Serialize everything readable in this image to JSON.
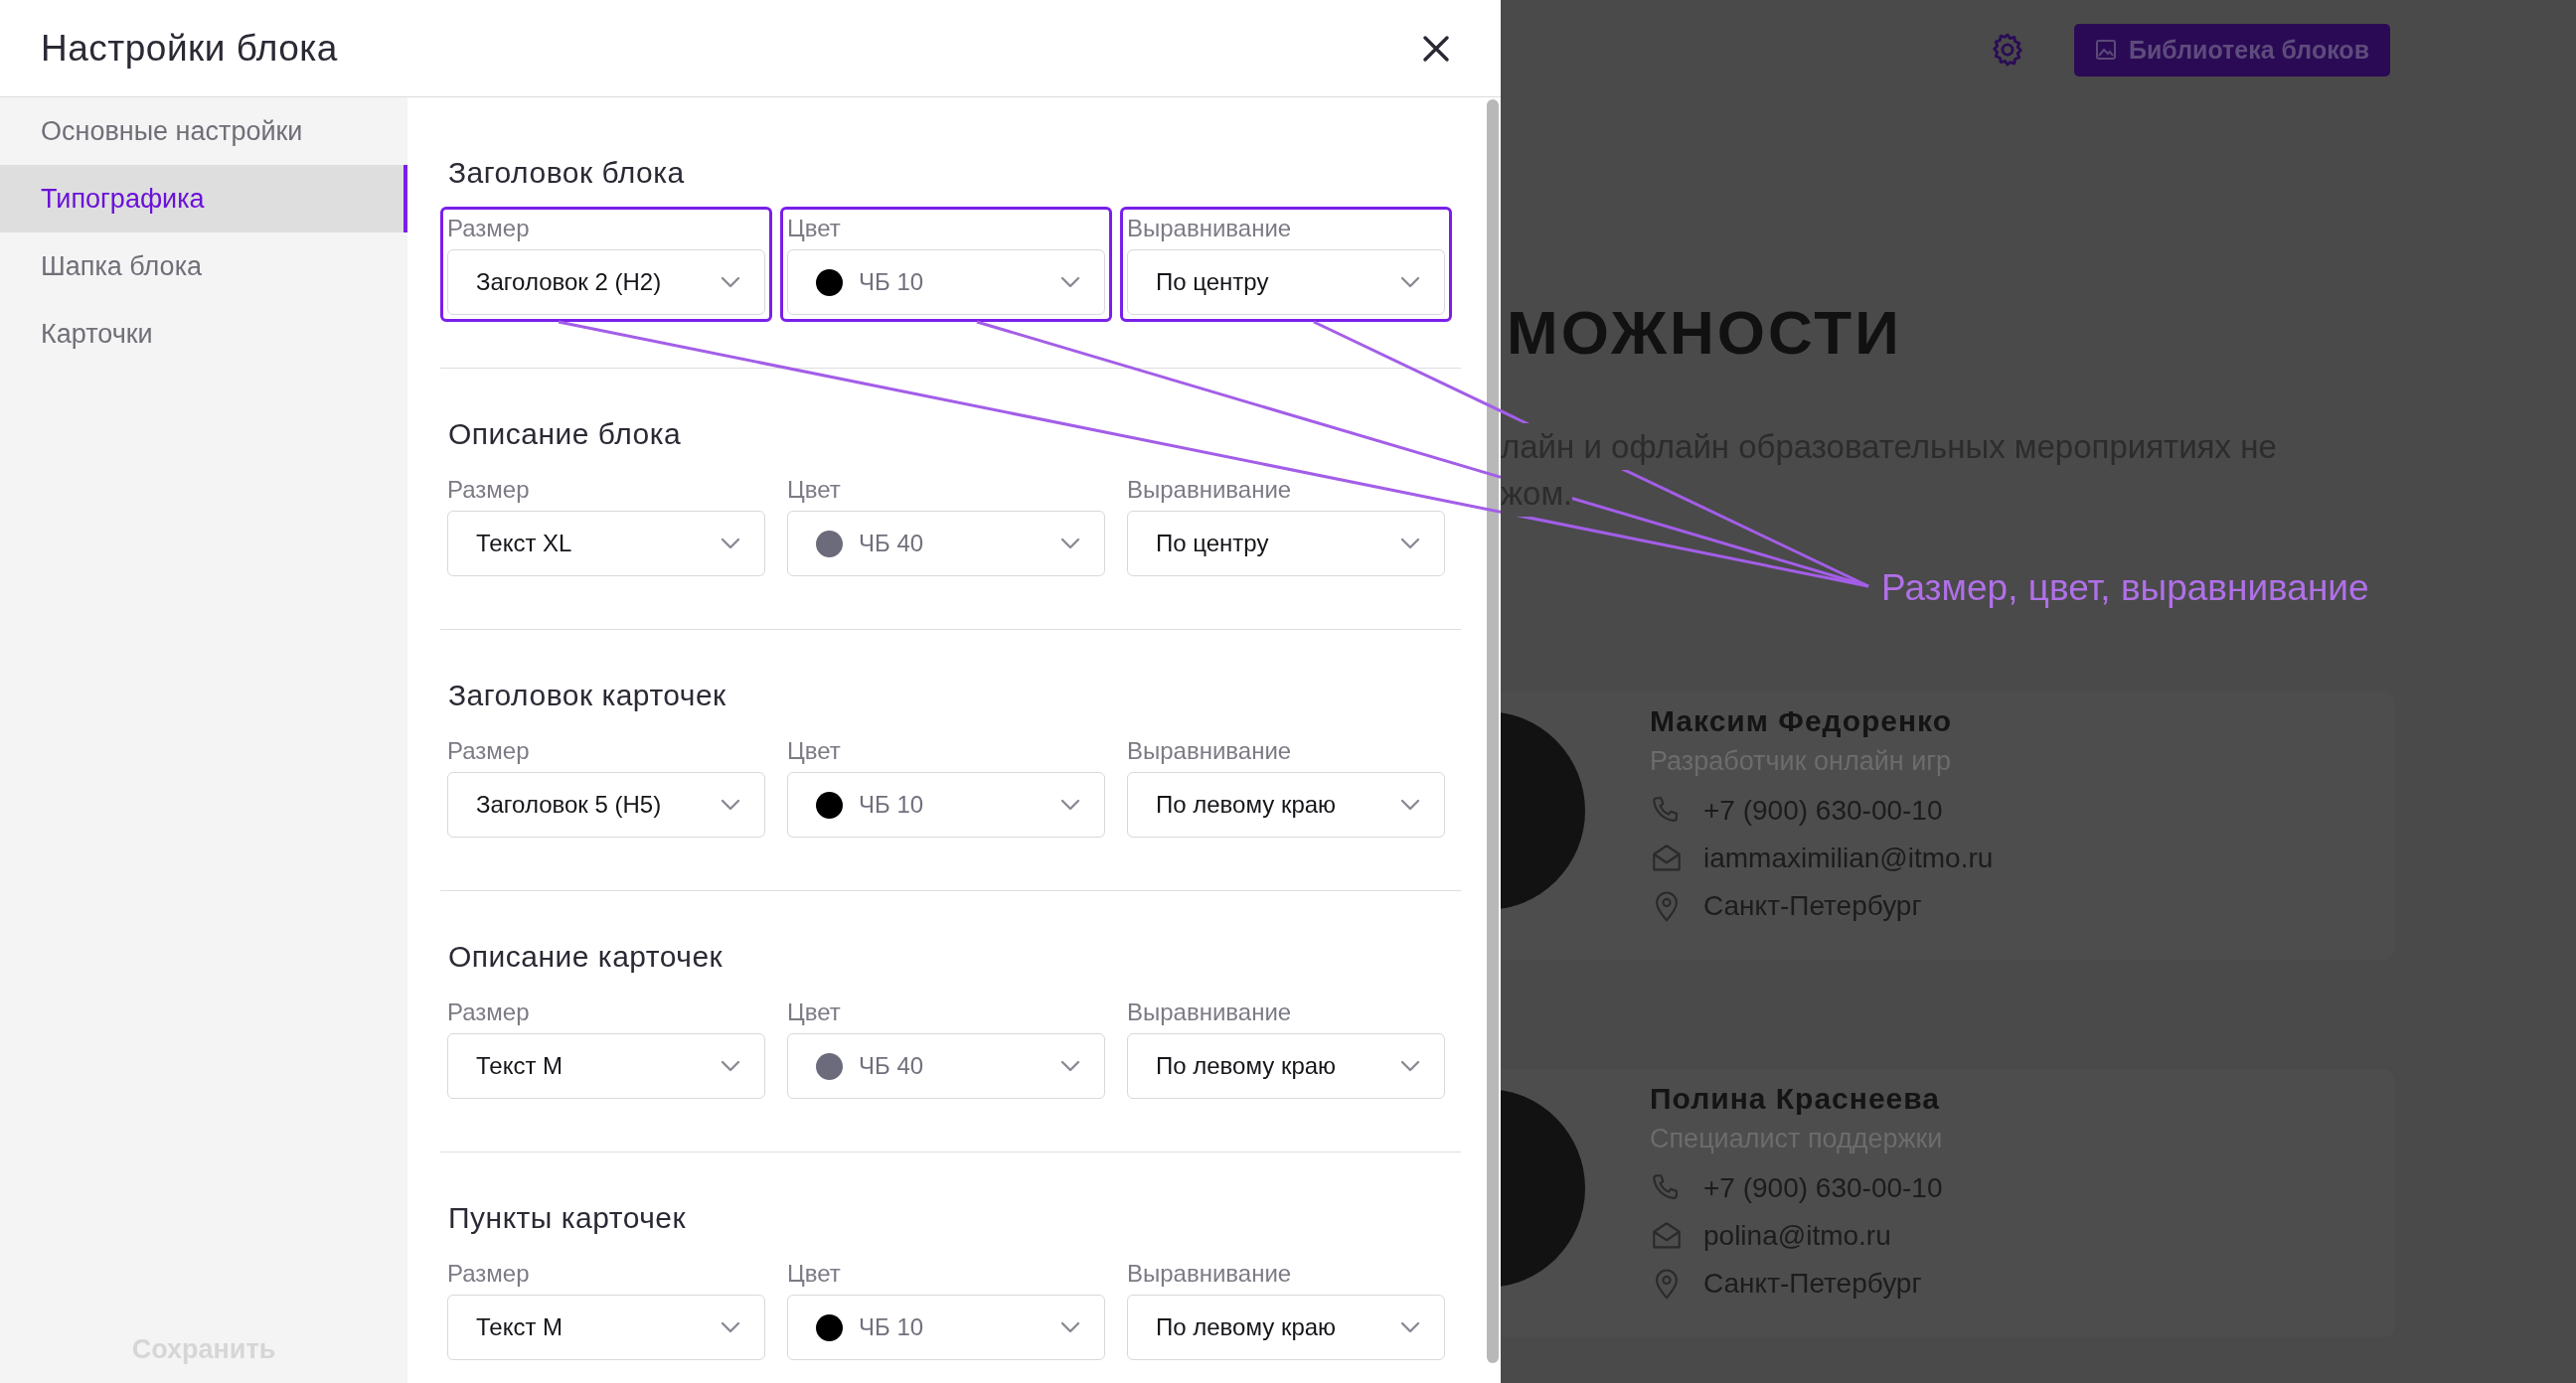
{
  "modal": {
    "title": "Настройки блока",
    "sidebar": {
      "items": [
        {
          "label": "Основные настройки",
          "selected": false
        },
        {
          "label": "Типографика",
          "selected": true
        },
        {
          "label": "Шапка блока",
          "selected": false
        },
        {
          "label": "Карточки",
          "selected": false
        }
      ],
      "save_button": {
        "label": "Сохранить",
        "disabled": true
      }
    },
    "sections": [
      {
        "title": "Заголовок блока",
        "fields": [
          {
            "kind": "select",
            "label": "Размер",
            "value": "Заголовок 2 (H2)",
            "highlighted": true
          },
          {
            "kind": "color",
            "label": "Цвет",
            "value": "ЧБ 10",
            "color": "#000000",
            "highlighted": true
          },
          {
            "kind": "select",
            "label": "Выравнивание",
            "value": "По центру",
            "highlighted": true
          }
        ]
      },
      {
        "title": "Описание блока",
        "fields": [
          {
            "kind": "select",
            "label": "Размер",
            "value": "Текст XL",
            "highlighted": false
          },
          {
            "kind": "color",
            "label": "Цвет",
            "value": "ЧБ 40",
            "color": "#6b6b7b",
            "highlighted": false
          },
          {
            "kind": "select",
            "label": "Выравнивание",
            "value": "По центру",
            "highlighted": false
          }
        ]
      },
      {
        "title": "Заголовок карточек",
        "fields": [
          {
            "kind": "select",
            "label": "Размер",
            "value": "Заголовок 5 (H5)",
            "highlighted": false
          },
          {
            "kind": "color",
            "label": "Цвет",
            "value": "ЧБ 10",
            "color": "#000000",
            "highlighted": false
          },
          {
            "kind": "select",
            "label": "Выравнивание",
            "value": "По левому краю",
            "highlighted": false
          }
        ]
      },
      {
        "title": "Описание карточек",
        "fields": [
          {
            "kind": "select",
            "label": "Размер",
            "value": "Текст M",
            "highlighted": false
          },
          {
            "kind": "color",
            "label": "Цвет",
            "value": "ЧБ 40",
            "color": "#6b6b7b",
            "highlighted": false
          },
          {
            "kind": "select",
            "label": "Выравнивание",
            "value": "По левому краю",
            "highlighted": false
          }
        ]
      },
      {
        "title": "Пункты карточек",
        "fields": [
          {
            "kind": "select",
            "label": "Размер",
            "value": "Текст M",
            "highlighted": false
          },
          {
            "kind": "color",
            "label": "Цвет",
            "value": "ЧБ 10",
            "color": "#000000",
            "highlighted": false
          },
          {
            "kind": "select",
            "label": "Выравнивание",
            "value": "По левому краю",
            "highlighted": false
          }
        ]
      }
    ]
  },
  "annotation": {
    "text": "Размер, цвет, выравнивание"
  },
  "page": {
    "library_button": "Библиотека блоков",
    "heading": "МОЖНОСТИ",
    "description": [
      "лайн и офлайн образовательных мероприятиях не",
      "жом."
    ],
    "cards": [
      {
        "name": "Максим Федоренко",
        "role": "Разработчик онлайн игр",
        "phone": "+7 (900) 630-00-10",
        "email": "iammaximilian@itmo.ru",
        "city": "Санкт-Петербург"
      },
      {
        "name": "Полина Краснеева",
        "role": "Специалист поддержки",
        "phone": "+7 (900) 630-00-10",
        "email": "polina@itmo.ru",
        "city": "Санкт-Петербург"
      }
    ]
  }
}
